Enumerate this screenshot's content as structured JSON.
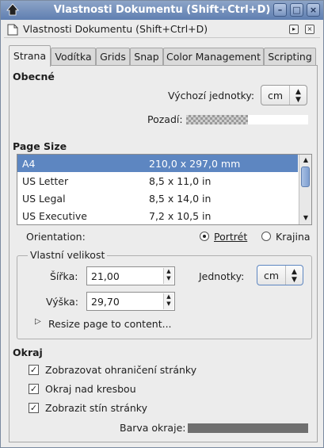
{
  "window": {
    "title": "Vlastnosti Dokumentu (Shift+Ctrl+D)"
  },
  "dock": {
    "title": "Vlastnosti Dokumentu (Shift+Ctrl+D)"
  },
  "tabs": [
    {
      "label": "Strana",
      "active": true
    },
    {
      "label": "Vodítka",
      "active": false
    },
    {
      "label": "Grids",
      "active": false
    },
    {
      "label": "Snap",
      "active": false
    },
    {
      "label": "Color Management",
      "active": false
    },
    {
      "label": "Scripting",
      "active": false
    }
  ],
  "general": {
    "heading": "Obecné",
    "default_units_label": "Výchozí jednotky:",
    "default_units_value": "cm",
    "background_label": "Pozadí:"
  },
  "page_size": {
    "heading": "Page Size",
    "rows": [
      {
        "name": "A4",
        "size": "210,0 x 297,0 mm",
        "selected": true
      },
      {
        "name": "US Letter",
        "size": "8,5 x 11,0 in",
        "selected": false
      },
      {
        "name": "US Legal",
        "size": "8,5 x 14,0 in",
        "selected": false
      },
      {
        "name": "US Executive",
        "size": "7,2 x 10,5 in",
        "selected": false
      }
    ],
    "orientation_label": "Orientation:",
    "portrait_label": "Portrét",
    "landscape_label": "Krajina",
    "orientation_selected": "portrait"
  },
  "custom_size": {
    "heading": "Vlastní velikost",
    "width_label": "Šířka:",
    "width_value": "21,00",
    "height_label": "Výška:",
    "height_value": "29,70",
    "units_label": "Jednotky:",
    "units_value": "cm",
    "resize_label": "Resize page to content..."
  },
  "border": {
    "heading": "Okraj",
    "show_border_label": "Zobrazovat ohraničení stránky",
    "border_on_top_label": "Okraj nad kresbou",
    "show_shadow_label": "Zobrazit stín stránky",
    "color_label": "Barva okraje:",
    "color": "#6f6f6f"
  },
  "colors": {
    "title_bar": "#5f7fb1",
    "selection": "#5d86c1"
  }
}
